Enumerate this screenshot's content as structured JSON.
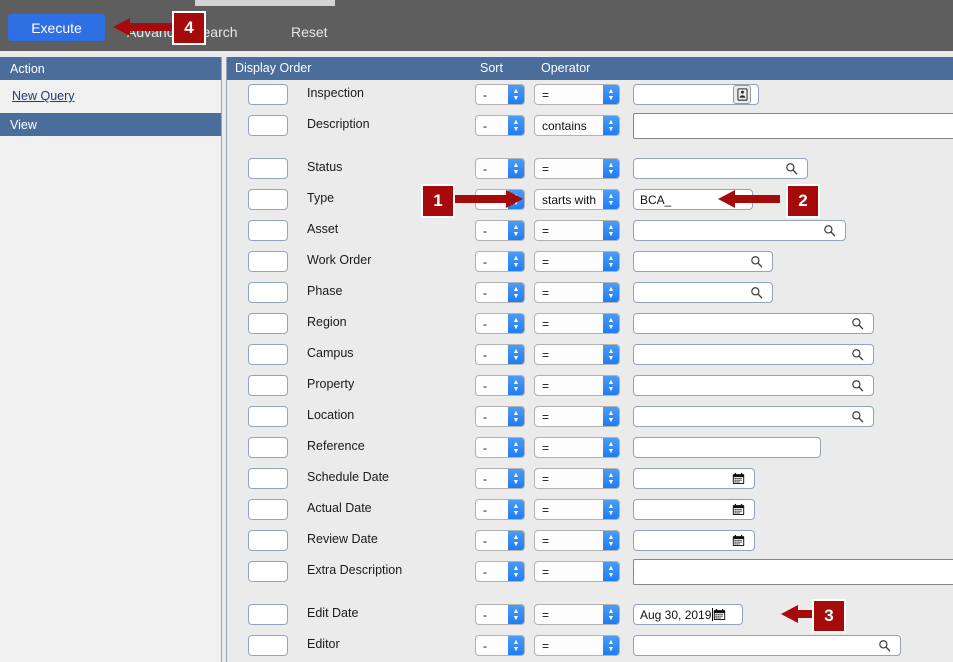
{
  "window": {
    "tab_label": ""
  },
  "toolbar": {
    "execute_label": "Execute",
    "advanced_search_label": "Advanced Search",
    "reset_label": "Reset",
    "execute_color": "#2f6fe4",
    "bar_color": "#5e5e5e"
  },
  "sidebar": {
    "action_header": "Action",
    "new_query_label": "New Query",
    "view_header": "View",
    "header_color": "#4a6d9c"
  },
  "grid": {
    "headers": {
      "display_order": "Display Order",
      "sort": "Sort",
      "operator": "Operator"
    },
    "rows": [
      {
        "label": "Inspection",
        "order": "",
        "sort": "-",
        "operator": "=",
        "value": "",
        "value_widget": "picker-button",
        "value_width": 126,
        "gap_before": false
      },
      {
        "label": "Description",
        "order": "",
        "sort": "-",
        "operator": "contains",
        "value": "",
        "value_widget": "textarea",
        "value_width": 340,
        "gap_before": false
      },
      {
        "label": "Status",
        "order": "",
        "sort": "-",
        "operator": "=",
        "value": "",
        "value_widget": "search",
        "value_width": 175,
        "gap_before": true
      },
      {
        "label": "Type",
        "order": "",
        "sort": "",
        "operator": "starts with",
        "value": "BCA_",
        "value_widget": "text",
        "value_width": 120,
        "gap_before": false
      },
      {
        "label": "Asset",
        "order": "",
        "sort": "-",
        "operator": "=",
        "value": "",
        "value_widget": "search",
        "value_width": 213,
        "gap_before": false
      },
      {
        "label": "Work Order",
        "order": "",
        "sort": "-",
        "operator": "=",
        "value": "",
        "value_widget": "search",
        "value_width": 140,
        "gap_before": false
      },
      {
        "label": "Phase",
        "order": "",
        "sort": "-",
        "operator": "=",
        "value": "",
        "value_widget": "search",
        "value_width": 140,
        "gap_before": false
      },
      {
        "label": "Region",
        "order": "",
        "sort": "-",
        "operator": "=",
        "value": "",
        "value_widget": "search",
        "value_width": 241,
        "gap_before": false
      },
      {
        "label": "Campus",
        "order": "",
        "sort": "-",
        "operator": "=",
        "value": "",
        "value_widget": "search",
        "value_width": 241,
        "gap_before": false
      },
      {
        "label": "Property",
        "order": "",
        "sort": "-",
        "operator": "=",
        "value": "",
        "value_widget": "search",
        "value_width": 241,
        "gap_before": false
      },
      {
        "label": "Location",
        "order": "",
        "sort": "-",
        "operator": "=",
        "value": "",
        "value_widget": "search",
        "value_width": 241,
        "gap_before": false
      },
      {
        "label": "Reference",
        "order": "",
        "sort": "-",
        "operator": "=",
        "value": "",
        "value_widget": "text",
        "value_width": 188,
        "gap_before": false
      },
      {
        "label": "Schedule Date",
        "order": "",
        "sort": "-",
        "operator": "=",
        "value": "",
        "value_widget": "date",
        "value_width": 122,
        "gap_before": false
      },
      {
        "label": "Actual Date",
        "order": "",
        "sort": "-",
        "operator": "=",
        "value": "",
        "value_widget": "date",
        "value_width": 122,
        "gap_before": false
      },
      {
        "label": "Review Date",
        "order": "",
        "sort": "-",
        "operator": "=",
        "value": "",
        "value_widget": "date",
        "value_width": 122,
        "gap_before": false
      },
      {
        "label": "Extra Description",
        "order": "",
        "sort": "-",
        "operator": "=",
        "value": "",
        "value_widget": "textarea",
        "value_width": 340,
        "gap_before": false
      },
      {
        "label": "Edit Date",
        "order": "",
        "sort": "-",
        "operator": "=",
        "value": "Aug 30, 2019",
        "value_widget": "date-filled",
        "value_width": 110,
        "gap_before": true
      },
      {
        "label": "Editor",
        "order": "",
        "sort": "-",
        "operator": "=",
        "value": "",
        "value_widget": "search",
        "value_width": 268,
        "gap_before": false
      }
    ]
  },
  "annotations": {
    "color": "#a50b0b",
    "markers": [
      {
        "id": "1",
        "label": "1",
        "target": "type-sort-select"
      },
      {
        "id": "2",
        "label": "2",
        "target": "type-value-input"
      },
      {
        "id": "3",
        "label": "3",
        "target": "edit-date-value-input"
      },
      {
        "id": "4",
        "label": "4",
        "target": "advanced-search-link"
      }
    ]
  }
}
